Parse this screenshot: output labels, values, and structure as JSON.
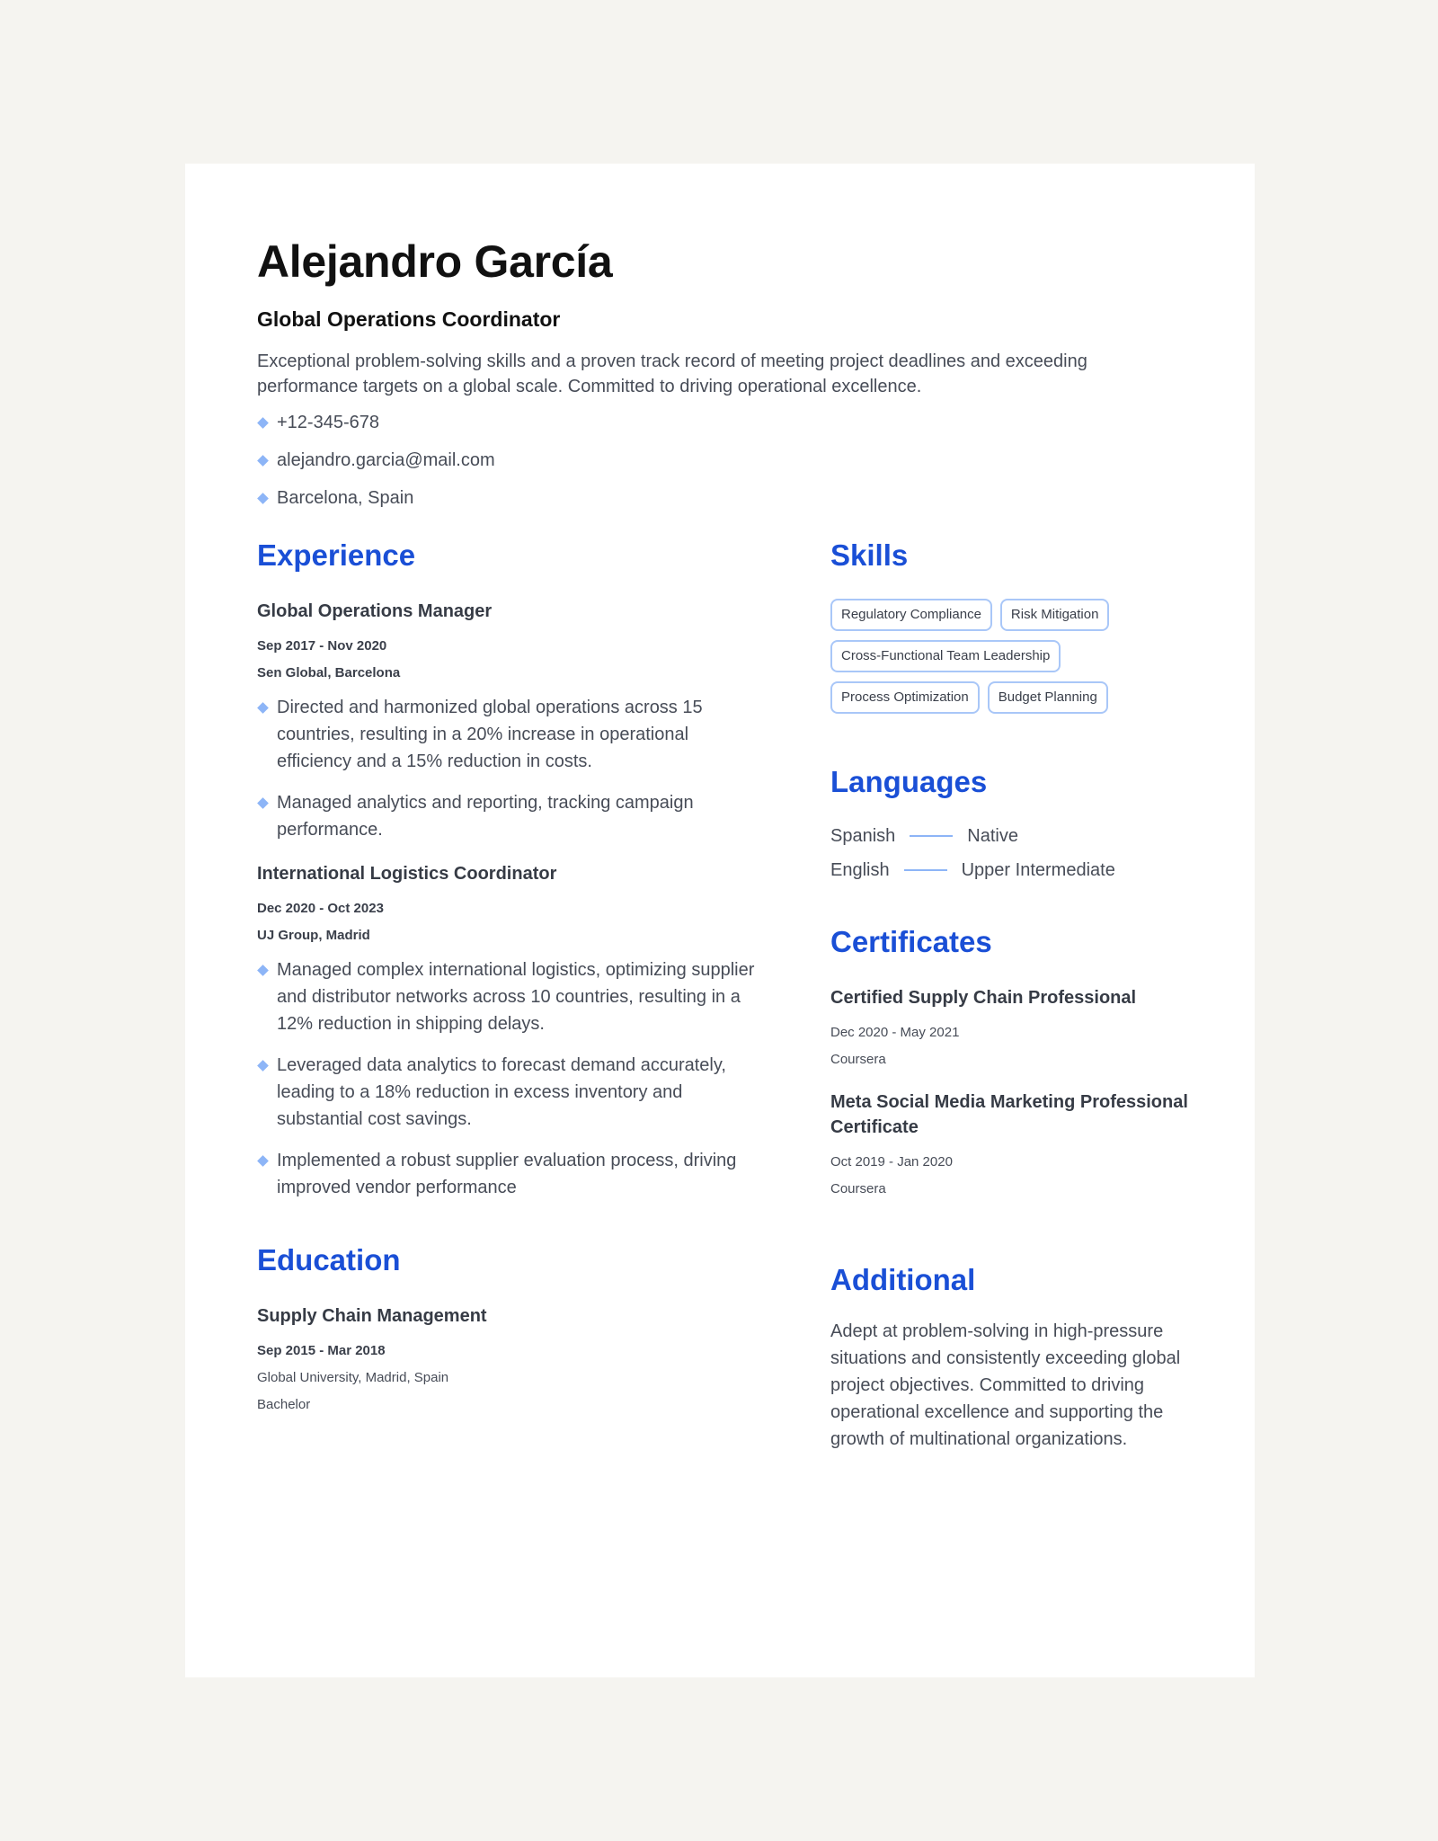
{
  "header": {
    "name": "Alejandro García",
    "title": "Global Operations Coordinator",
    "summary": "Exceptional problem-solving skills and a proven track record of meeting project deadlines and exceeding performance targets on a global scale. Committed to driving operational excellence."
  },
  "contact": {
    "phone": "+12-345-678",
    "email": "alejandro.garcia@mail.com",
    "location": "Barcelona, Spain"
  },
  "experience": {
    "heading": "Experience",
    "jobs": [
      {
        "title": "Global Operations Manager",
        "dates": "Sep 2017 - Nov 2020",
        "company": "Sen Global, Barcelona",
        "bullets": [
          "Directed and harmonized global operations across 15 countries, resulting in a 20% increase in operational efficiency and a 15% reduction in costs.",
          "Managed analytics and reporting, tracking campaign performance."
        ]
      },
      {
        "title": "International Logistics Coordinator",
        "dates": "Dec 2020 - Oct 2023",
        "company": "UJ Group, Madrid",
        "bullets": [
          "Managed complex international logistics, optimizing supplier and distributor networks across 10 countries, resulting in a 12% reduction in shipping delays.",
          "Leveraged data analytics to forecast demand accurately, leading to a 18% reduction in excess inventory and substantial cost savings.",
          "Implemented a robust supplier evaluation process, driving improved vendor performance"
        ]
      }
    ]
  },
  "education": {
    "heading": "Education",
    "degree": "Supply Chain Management",
    "dates": "Sep 2015 - Mar 2018",
    "school": "Global University, Madrid, Spain",
    "level": "Bachelor"
  },
  "skills": {
    "heading": "Skills",
    "items": [
      "Regulatory Compliance",
      "Risk Mitigation",
      "Cross-Functional Team Leadership",
      "Process Optimization",
      "Budget Planning"
    ]
  },
  "languages": {
    "heading": "Languages",
    "items": [
      {
        "name": "Spanish",
        "level": "Native"
      },
      {
        "name": "English",
        "level": "Upper Intermediate"
      }
    ]
  },
  "certificates": {
    "heading": "Certificates",
    "items": [
      {
        "title": "Certified Supply Chain Professional",
        "dates": "Dec 2020 - May 2021",
        "issuer": "Coursera"
      },
      {
        "title": "Meta Social Media Marketing Professional Certificate",
        "dates": "Oct 2019 - Jan 2020",
        "issuer": "Coursera"
      }
    ]
  },
  "additional": {
    "heading": "Additional",
    "text": "Adept at problem-solving in high-pressure situations and consistently exceeding global project objectives. Committed to driving operational excellence and supporting the growth of multinational organizations."
  },
  "colors": {
    "accent": "#1a4fd6",
    "bullet": "#8db5f7",
    "chip_border": "#a9c7f8",
    "background": "#f5f4f0"
  }
}
